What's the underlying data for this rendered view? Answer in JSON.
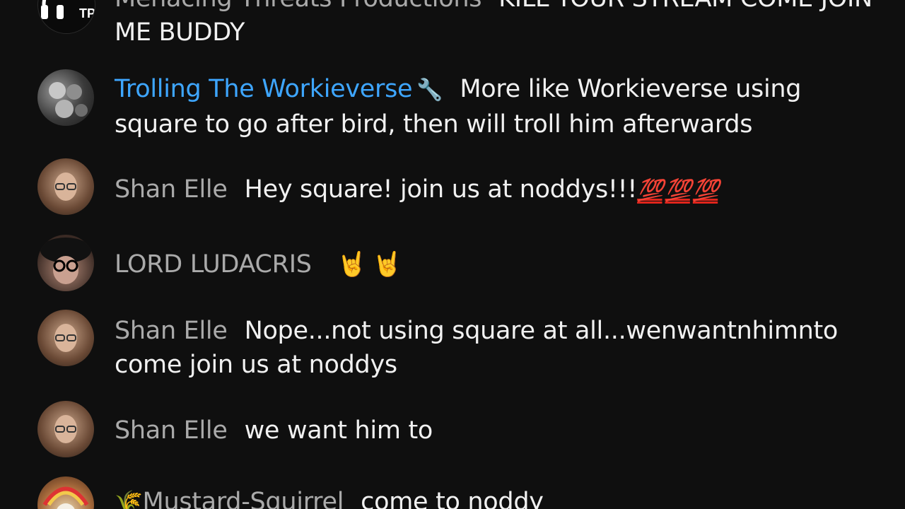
{
  "chat": {
    "messages": [
      {
        "author": "Menacing Threats Productions",
        "text": "KILL YOUR STREAM COME JOIN ME BUDDY",
        "avatar_icon": "mtp-logo-avatar"
      },
      {
        "author": "Trolling The Workieverse",
        "badge_icon": "wrench-icon",
        "text": "More like Workieverse using square to go after bird, then will troll him afterwards",
        "avatar_icon": "face-collage-avatar"
      },
      {
        "author": "Shan Elle",
        "text": "Hey square! join us at noddys!!!",
        "emoji_icon": "hundred-points-icon",
        "avatar_icon": "woman-glasses-avatar"
      },
      {
        "author": "LORD LUDACRIS",
        "text": "",
        "emoji_icon": "sign-of-horns-icon",
        "avatar_icon": "man-hat-glasses-avatar"
      },
      {
        "author": "Shan Elle",
        "text": "Nope...not using square at all...wenwantnhimnto come join us at noddys",
        "avatar_icon": "woman-glasses-avatar"
      },
      {
        "author": "Shan Elle",
        "text": "we want him to",
        "avatar_icon": "woman-glasses-avatar"
      },
      {
        "author": "Mustard-Squirrel",
        "author_prefix_icon": "corn-icon",
        "text": "come to noddy",
        "avatar_icon": "headdress-skull-avatar"
      }
    ],
    "glyphs": {
      "wrench": "🔧",
      "hundred": "💯",
      "horns": "🤘",
      "corn": "🌾"
    }
  },
  "colors": {
    "background": "#0f0f0f",
    "author": "#aaaaaa",
    "moderator_author": "#3ea6ff",
    "message_text": "#f1f1f1"
  }
}
